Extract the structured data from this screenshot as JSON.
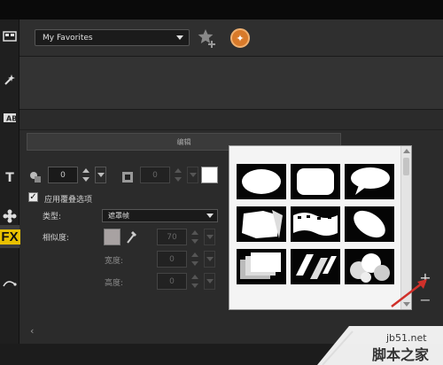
{
  "toolbar": {
    "favorites_value": "My Favorites",
    "add_favorite_icon": "star-plus-icon",
    "medal_icon": "medal-icon"
  },
  "rail": {
    "items": [
      {
        "icon": "media-icon"
      },
      {
        "icon": "instant-project-icon"
      },
      {
        "icon": "transition-icon"
      },
      {
        "icon": "title-icon"
      },
      {
        "icon": "graphic-icon"
      },
      {
        "icon": "fx-filter-icon",
        "label": "FX",
        "active": true
      },
      {
        "icon": "path-icon"
      }
    ]
  },
  "edit": {
    "label": "编辑"
  },
  "controls": {
    "border_width_value": "0",
    "shadow_value": "0",
    "apply_overlay_label": "应用覆叠选项",
    "apply_overlay_checked": true,
    "type_label": "类型:",
    "type_value": "遮罩帧",
    "similarity_label": "相似度:",
    "similarity_value": "70",
    "width_label": "宽度:",
    "width_value": "0",
    "height_label": "高度:",
    "height_value": "0"
  },
  "gallery": {
    "masks": [
      "oval-mask",
      "rounded-rect-mask",
      "speech-bubble-mask",
      "torn-paper-mask",
      "film-strip-mask",
      "rotated-oval-mask",
      "layered-rect-mask",
      "broken-bars-mask",
      "bubbles-mask"
    ]
  },
  "colors": {
    "accent": "#e8c000",
    "swatch_white": "#ffffff",
    "swatch_gray": "#a8a2a2",
    "arrow_red": "#d0302a"
  },
  "watermark": {
    "url": "jb51.net",
    "brand": "脚本之家"
  }
}
